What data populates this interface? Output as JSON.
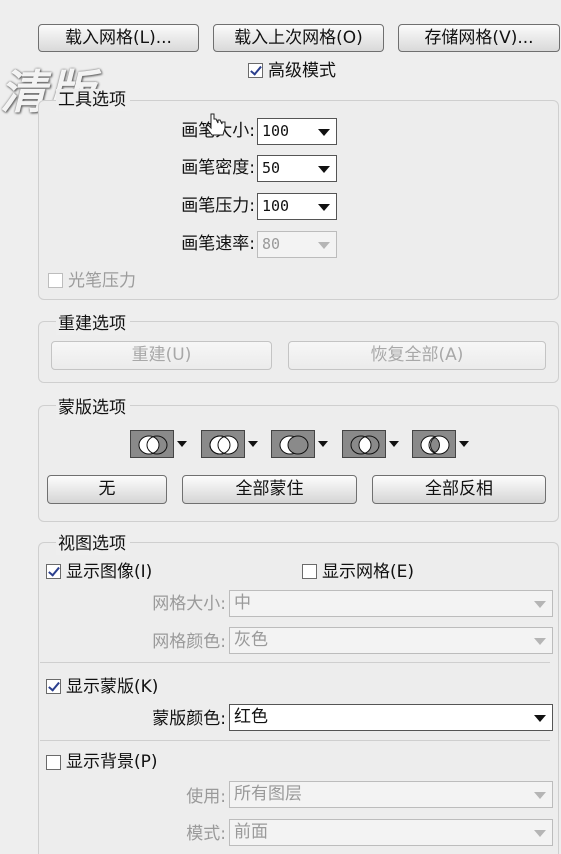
{
  "top_buttons": {
    "load_mesh": "载入网格(L)...",
    "load_last_mesh": "载入上次网格(O)",
    "save_mesh": "存储网格(V)..."
  },
  "advanced_mode": {
    "label": "高级模式",
    "checked": true
  },
  "watermark": "清版",
  "tool_options": {
    "legend": "工具选项",
    "brush_size_label": "画笔大小:",
    "brush_size_value": "100",
    "brush_density_label": "画笔密度:",
    "brush_density_value": "50",
    "brush_pressure_label": "画笔压力:",
    "brush_pressure_value": "100",
    "brush_rate_label": "画笔速率:",
    "brush_rate_value": "80",
    "stylus_pressure_label": "光笔压力"
  },
  "reconstruct_options": {
    "legend": "重建选项",
    "reconstruct_button": "重建(U)",
    "restore_all_button": "恢复全部(A)"
  },
  "mask_options": {
    "legend": "蒙版选项",
    "mask_modes": [
      "replace-selection-icon",
      "add-to-selection-icon",
      "subtract-from-selection-icon",
      "intersect-selection-icon",
      "invert-selection-icon"
    ],
    "none_button": "无",
    "mask_all_button": "全部蒙住",
    "invert_all_button": "全部反相"
  },
  "view_options": {
    "legend": "视图选项",
    "show_image_label": "显示图像(I)",
    "show_mesh_label": "显示网格(E)",
    "mesh_size_label": "网格大小:",
    "mesh_size_value": "中",
    "mesh_color_label": "网格颜色:",
    "mesh_color_value": "灰色",
    "show_mask_label": "显示蒙版(K)",
    "mask_color_label": "蒙版颜色:",
    "mask_color_value": "红色",
    "show_backdrop_label": "显示背景(P)",
    "use_label": "使用:",
    "use_value": "所有图层",
    "mode_label": "模式:",
    "mode_value": "前面"
  },
  "colors": {
    "panel_bg": "#eeeeee",
    "check_mark": "#2b3f8e",
    "disabled_text": "#9a9a9a"
  }
}
